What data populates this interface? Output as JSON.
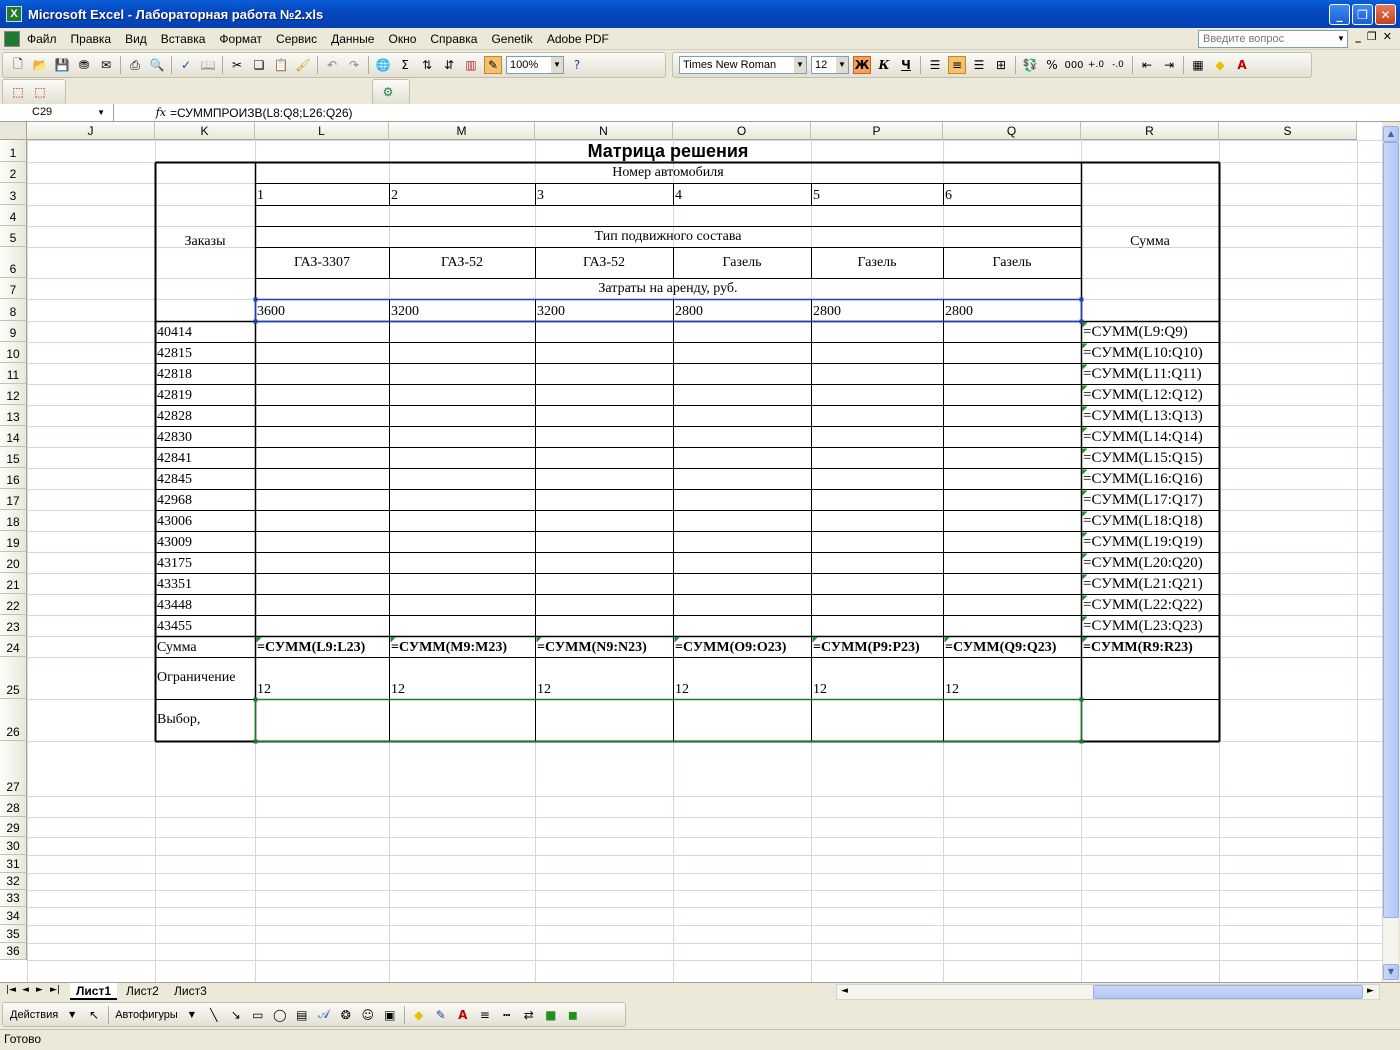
{
  "window": {
    "title": "Microsoft Excel - Лабораторная работа №2.xls",
    "app_icon": "X",
    "min": "_",
    "restore": "❐",
    "close": "✕"
  },
  "menu": {
    "items": [
      "Файл",
      "Правка",
      "Вид",
      "Вставка",
      "Формат",
      "Сервис",
      "Данные",
      "Окно",
      "Справка",
      "Genetik",
      "Adobe PDF"
    ],
    "ask_placeholder": "Введите вопрос"
  },
  "toolbar": {
    "zoom": "100%",
    "font_name": "Times New Roman",
    "font_size": "12",
    "bold": "Ж",
    "italic": "К",
    "underline": "Ч",
    "percent": "%",
    "thousands": "000"
  },
  "formula_bar": {
    "name_box": "C29",
    "fx": "fx",
    "formula": "=СУММПРОИЗВ(L8:Q8;L26:Q26)"
  },
  "columns": [
    "J",
    "K",
    "L",
    "M",
    "N",
    "O",
    "P",
    "Q",
    "R",
    "S"
  ],
  "rows": [
    "1",
    "2",
    "3",
    "4",
    "5",
    "6",
    "7",
    "8",
    "9",
    "10",
    "11",
    "12",
    "13",
    "14",
    "15",
    "16",
    "17",
    "18",
    "19",
    "20",
    "21",
    "22",
    "23",
    "24",
    "25",
    "26",
    "27",
    "28",
    "29",
    "30",
    "31",
    "32",
    "33",
    "34",
    "35",
    "36"
  ],
  "matrix": {
    "title": "Матрица решения",
    "orders_label": "Заказы",
    "car_number_label": "Номер автомобиля",
    "car_numbers": [
      "1",
      "2",
      "3",
      "4",
      "5",
      "6"
    ],
    "stock_type_label": "Тип подвижного состава",
    "stock_types": [
      "ГАЗ-3307",
      "ГАЗ-52",
      "ГАЗ-52",
      "Газель",
      "Газель",
      "Газель"
    ],
    "rent_label": "Затраты на аренду, руб.",
    "rent_costs": [
      "3600",
      "3200",
      "3200",
      "2800",
      "2800",
      "2800"
    ],
    "sum_label": "Сумма",
    "orders": [
      "40414",
      "42815",
      "42818",
      "42819",
      "42828",
      "42830",
      "42841",
      "42845",
      "42968",
      "43006",
      "43009",
      "43175",
      "43351",
      "43448",
      "43455"
    ],
    "row_sums": [
      "=СУММ(L9:Q9)",
      "=СУММ(L10:Q10)",
      "=СУММ(L11:Q11)",
      "=СУММ(L12:Q12)",
      "=СУММ(L13:Q13)",
      "=СУММ(L14:Q14)",
      "=СУММ(L15:Q15)",
      "=СУММ(L16:Q16)",
      "=СУММ(L17:Q17)",
      "=СУММ(L18:Q18)",
      "=СУММ(L19:Q19)",
      "=СУММ(L20:Q20)",
      "=СУММ(L21:Q21)",
      "=СУММ(L22:Q22)",
      "=СУММ(L23:Q23)"
    ],
    "sum_row_label": "Сумма",
    "col_sums": [
      "=СУММ(L9:L23)",
      "=СУММ(M9:M23)",
      "=СУММ(N9:N23)",
      "=СУММ(O9:O23)",
      "=СУММ(P9:P23)",
      "=СУММ(Q9:Q23)"
    ],
    "grand_sum": "=СУММ(R9:R23)",
    "limit_label": "Ограничение",
    "limits": [
      "12",
      "12",
      "12",
      "12",
      "12",
      "12"
    ],
    "choice_label": "Выбор,"
  },
  "sheets": {
    "tabs": [
      "Лист1",
      "Лист2",
      "Лист3"
    ],
    "active": "Лист1"
  },
  "drawing": {
    "actions": "Действия",
    "autoshapes": "Автофигуры"
  },
  "status": {
    "text": "Готово"
  },
  "colors": {
    "title_bar": "#0648c0",
    "grid": "#d0d7e5",
    "selection": "#1a3fbf",
    "sum_selection": "#1a7a2a"
  }
}
